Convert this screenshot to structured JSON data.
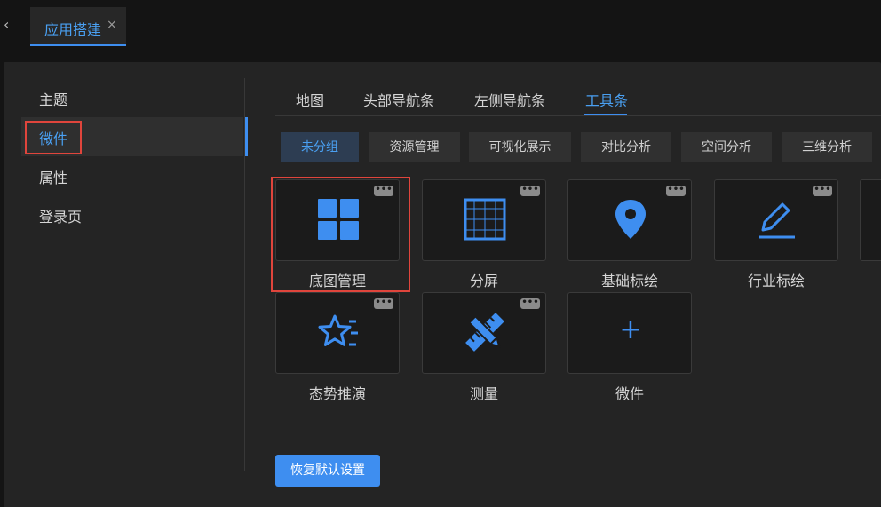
{
  "tabs": [
    {
      "label": "应用搭建",
      "close_glyph": "×"
    }
  ],
  "back_glyph": "‹",
  "sidebar": {
    "items": [
      {
        "label": "主题"
      },
      {
        "label": "微件"
      },
      {
        "label": "属性"
      },
      {
        "label": "登录页"
      }
    ]
  },
  "main": {
    "tabs": [
      {
        "label": "地图"
      },
      {
        "label": "头部导航条"
      },
      {
        "label": "左侧导航条"
      },
      {
        "label": "工具条"
      }
    ],
    "groups": [
      {
        "label": "未分组"
      },
      {
        "label": "资源管理"
      },
      {
        "label": "可视化展示"
      },
      {
        "label": "对比分析"
      },
      {
        "label": "空间分析"
      },
      {
        "label": "三维分析"
      }
    ],
    "widgets": [
      {
        "label": "底图管理",
        "icon": "grid-icon"
      },
      {
        "label": "分屏",
        "icon": "split-screen-icon"
      },
      {
        "label": "基础标绘",
        "icon": "map-pin-icon"
      },
      {
        "label": "行业标绘",
        "icon": "pencil-icon"
      },
      {
        "label": "态势推演",
        "icon": "star-list-icon"
      },
      {
        "label": "测量",
        "icon": "ruler-pencil-icon"
      },
      {
        "label": "微件",
        "icon": "plus-icon",
        "glyph": "+"
      }
    ],
    "more_glyph": "•••",
    "reset_button": "恢复默认设置"
  },
  "colors": {
    "accent": "#3e8ef0",
    "highlight_border": "#e0453c",
    "background": "#141414",
    "panel": "#242424"
  }
}
